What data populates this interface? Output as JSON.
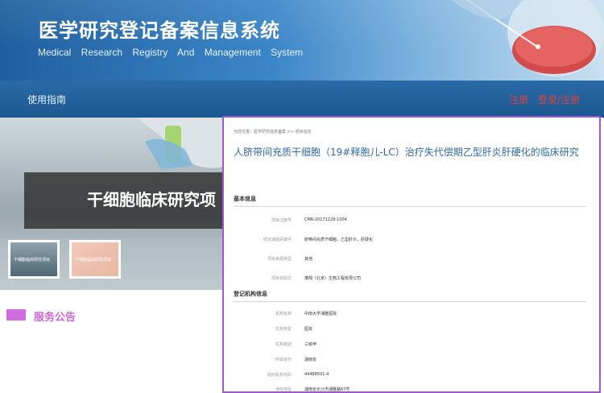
{
  "header": {
    "title_cn": "医学研究登记备案信息系统",
    "title_en": "Medical Research Registry And Management System"
  },
  "nav": {
    "guide": "使用指南",
    "register": "注册",
    "login": "登录/注册"
  },
  "hero": {
    "banner_text": "干细胞临床研究项",
    "thumb1_caption": "干细胞临床研究项目",
    "thumb2_caption": "干细胞临床研究项目"
  },
  "service": {
    "label": "服务公告"
  },
  "detail": {
    "breadcrumb": "当前位置：医学研究信息备案 >> 项目信息",
    "title": "人脐带间充质干细胞（19#释胞儿-LC）治疗失代偿期乙型肝炎肝硬化的临床研究",
    "basic_section": "基本信息",
    "basic_rows": [
      {
        "label": "项目注册号",
        "value": "CMR-20171228-1004"
      },
      {
        "label": "研究课题关键字",
        "value": "脐带间充质干细胞，乙型肝炎，肝硬化"
      },
      {
        "label": "项目来源类型",
        "value": "其他"
      },
      {
        "label": "项目资助方",
        "value": "蓬翔（北京）生物工程有限公司"
      }
    ],
    "org_section": "登记机构信息",
    "org_rows": [
      {
        "label": "机构名称",
        "value": "中南大学湘雅医院"
      },
      {
        "label": "机构类型",
        "value": "医院"
      },
      {
        "label": "机构级别",
        "value": "三级甲"
      },
      {
        "label": "所属省份",
        "value": "湖南省"
      },
      {
        "label": "组织机构代码",
        "value": "44488501-4"
      },
      {
        "label": "通信地址",
        "value": "湖南省长沙市湘雅路87号"
      }
    ]
  },
  "colors": {
    "header_blue": "#2a6aa8",
    "title_link_blue": "#2f6aa3",
    "accent_purple": "#cc66dd",
    "nav_red": "#d9443a"
  }
}
